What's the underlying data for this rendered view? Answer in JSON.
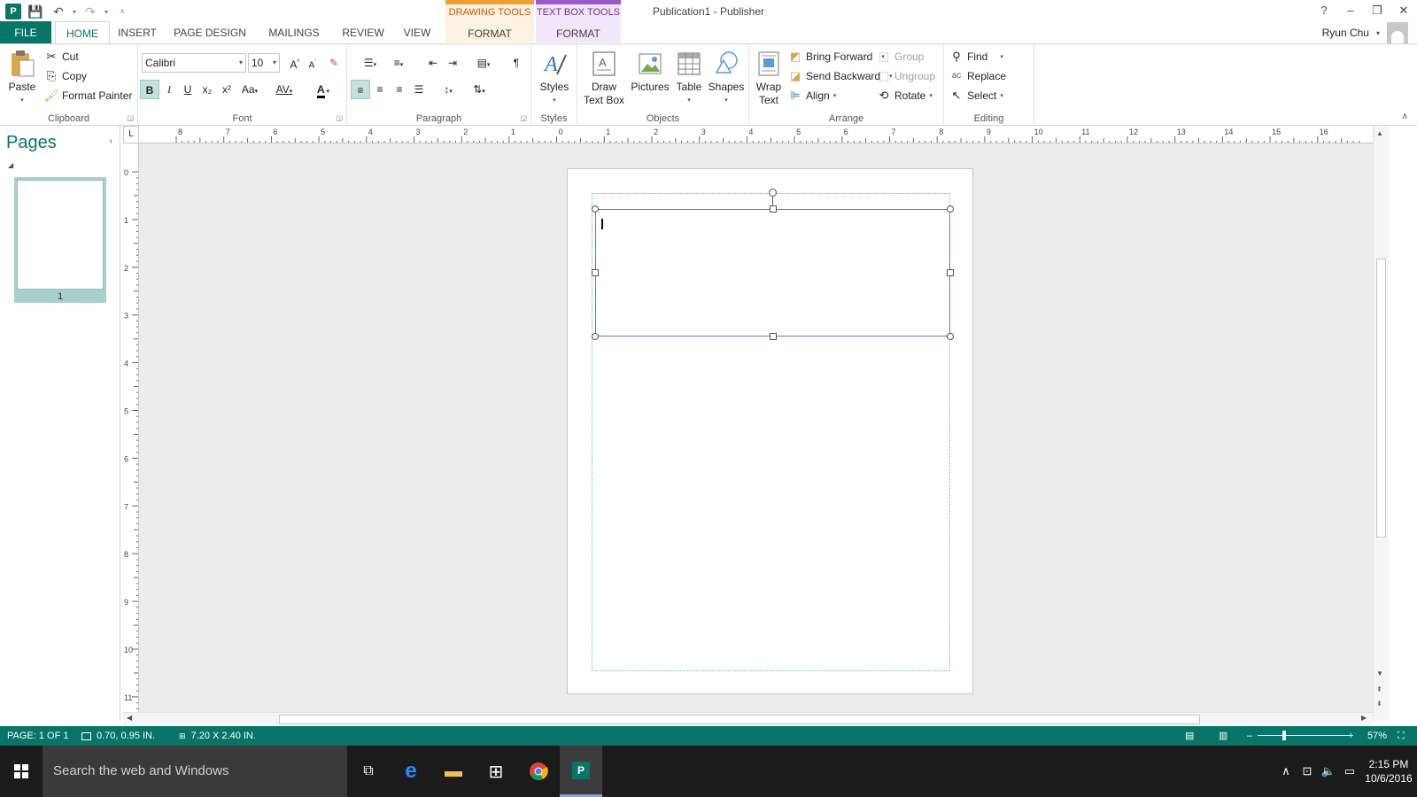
{
  "app": {
    "title": "Publication1 - Publisher",
    "icon_letter": "P",
    "context_tabs": [
      {
        "group": "DRAWING TOOLS",
        "tab": "FORMAT",
        "color": "#c55a11"
      },
      {
        "group": "TEXT BOX TOOLS",
        "tab": "FORMAT",
        "color": "#7030a0"
      }
    ],
    "window_controls": {
      "help": "?",
      "minimize": "–",
      "restore": "❐",
      "close": "✕"
    }
  },
  "tabs": [
    "FILE",
    "HOME",
    "INSERT",
    "PAGE DESIGN",
    "MAILINGS",
    "REVIEW",
    "VIEW"
  ],
  "user": {
    "name": "Ryun Chu"
  },
  "ribbon": {
    "clipboard": {
      "label": "Clipboard",
      "paste": "Paste",
      "cut": "Cut",
      "copy": "Copy",
      "format_painter": "Format Painter"
    },
    "font": {
      "label": "Font",
      "family": "Calibri",
      "size": "10",
      "bold": "B",
      "italic": "I",
      "underline": "U",
      "subscript": "x₂",
      "superscript": "x²",
      "change_case": "Aa",
      "spacing": "AV",
      "color_letter": "A",
      "grow": "A",
      "shrink": "A"
    },
    "paragraph": {
      "label": "Paragraph",
      "pilcrow": "¶"
    },
    "styles": {
      "label": "Styles",
      "button": "Styles"
    },
    "objects": {
      "label": "Objects",
      "draw_text_box_1": "Draw",
      "draw_text_box_2": "Text Box",
      "pictures": "Pictures",
      "table": "Table",
      "shapes": "Shapes"
    },
    "arrange": {
      "label": "Arrange",
      "wrap_1": "Wrap",
      "wrap_2": "Text",
      "bring_forward": "Bring Forward",
      "send_backward": "Send Backward",
      "align": "Align",
      "group": "Group",
      "ungroup": "Ungroup",
      "rotate": "Rotate"
    },
    "editing": {
      "label": "Editing",
      "find": "Find",
      "replace": "Replace",
      "select": "Select"
    }
  },
  "pages_pane": {
    "title": "Pages",
    "thumbnails": [
      {
        "number": "1"
      }
    ]
  },
  "rulers": {
    "corner": "L",
    "horizontal_labels": [
      "8",
      "7",
      "6",
      "5",
      "4",
      "3",
      "2",
      "1",
      "0",
      "1",
      "2",
      "3",
      "4",
      "5",
      "6",
      "7",
      "8",
      "9",
      "10",
      "11",
      "12",
      "13",
      "14",
      "15",
      "16"
    ],
    "vertical_labels": [
      "0",
      "1",
      "2",
      "3",
      "4",
      "5",
      "6",
      "7",
      "8",
      "9",
      "10",
      "11"
    ]
  },
  "status": {
    "page": "PAGE: 1 OF 1",
    "position": "0.70, 0.95 IN.",
    "size": "7.20 X 2.40 IN.",
    "zoom": "57%",
    "zoom_level": 0.57
  },
  "taskbar": {
    "search_placeholder": "Search the web and Windows",
    "time": "2:15 PM",
    "date": "10/6/2016",
    "pinned": [
      "task-view",
      "edge",
      "file-explorer",
      "store",
      "chrome",
      "publisher"
    ]
  },
  "colors": {
    "accent": "#077568",
    "drawing_tools": "#f0a030",
    "text_box_tools": "#9b59d0",
    "taskbar": "#1b1b1b"
  }
}
